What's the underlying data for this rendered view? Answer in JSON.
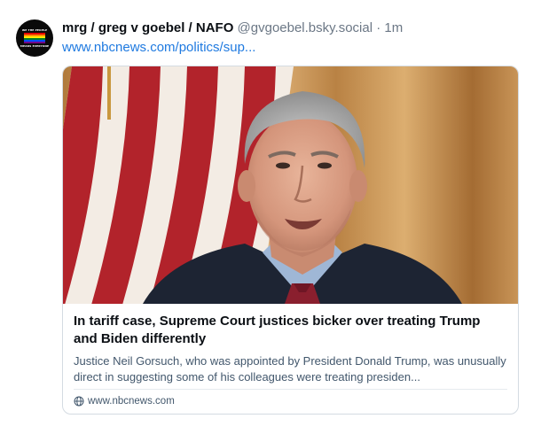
{
  "post": {
    "author": {
      "display_name": "mrg / greg v goebel / NAFO",
      "handle": "@gvgoebel.bsky.social",
      "separator": "·",
      "time": "1m",
      "avatar_text_top": "WE THE PEOPLE",
      "avatar_text_bottom": "MEANS EVERYONE"
    },
    "link_text": "www.nbcnews.com/politics/sup...",
    "card": {
      "image_description_icon": "photo",
      "title": "In tariff case, Supreme Court justices bicker over treating Trump and Biden differently",
      "description": "Justice Neil Gorsuch, who was appointed by President Donald Trump, was unusually direct in suggesting some of his colleagues were treating presiden...",
      "domain": "www.nbcnews.com",
      "domain_icon": "globe-icon"
    }
  },
  "colors": {
    "link": "#1f7ae0",
    "muted": "#6b7785",
    "border": "#d4dbe2"
  }
}
